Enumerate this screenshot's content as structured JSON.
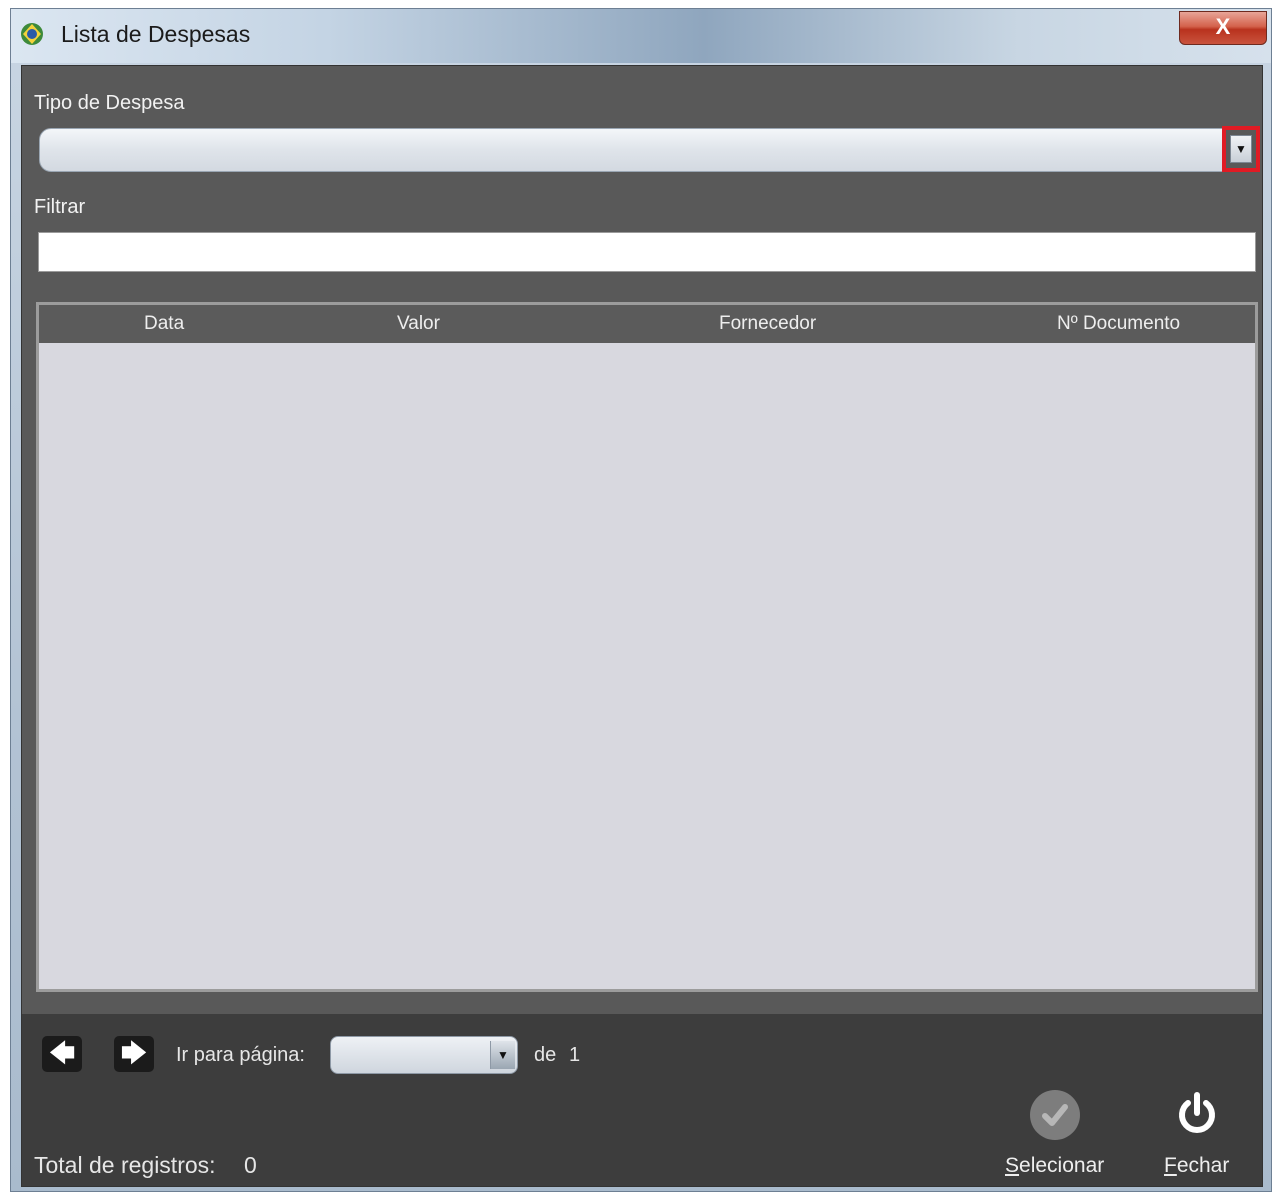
{
  "window": {
    "title": "Lista de Despesas",
    "close_label": "X",
    "app_icon": "app-globe-icon"
  },
  "form": {
    "tipo_label": "Tipo de Despesa",
    "tipo_value": "",
    "tipo_dropdown_icon": "chevron-down-icon",
    "filtrar_label": "Filtrar",
    "filtrar_value": ""
  },
  "table": {
    "columns": [
      "Data",
      "Valor",
      "Fornecedor",
      "Nº Documento"
    ],
    "rows": []
  },
  "pagination": {
    "prev_icon": "arrow-left-icon",
    "next_icon": "arrow-right-icon",
    "goto_label": "Ir para página:",
    "page_value": "",
    "de_label": "de",
    "total_pages": "1"
  },
  "footer": {
    "total_label": "Total de registros:",
    "total_value": "0",
    "select_label_first": "S",
    "select_label_rest": "elecionar",
    "close_label_first": "F",
    "close_label_rest": "echar"
  },
  "colors": {
    "panel": "#595959",
    "bottom_bar": "#3d3d3d",
    "highlight": "#e01b24"
  }
}
